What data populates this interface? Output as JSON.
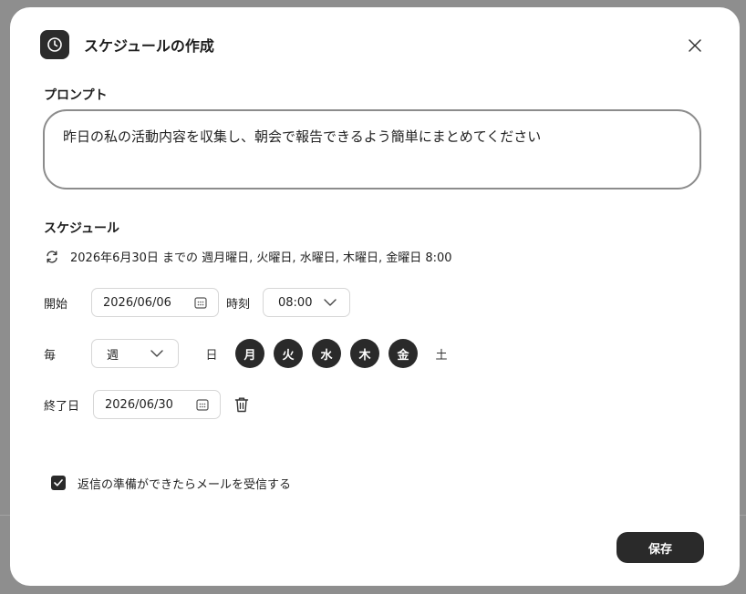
{
  "dialog": {
    "title": "スケジュールの作成",
    "header_icon": "clock-icon",
    "close_icon": "close-icon"
  },
  "prompt": {
    "label": "プロンプト",
    "value": "昨日の私の活動内容を収集し、朝会で報告できるよう簡単にまとめてください"
  },
  "schedule": {
    "label": "スケジュール",
    "summary_icon": "repeat-icon",
    "summary": "2026年6月30日 までの 週月曜日, 火曜日, 水曜日, 木曜日, 金曜日 8:00",
    "start_label": "開始",
    "start_date": "2026/06/06",
    "time_label": "時刻",
    "time_value": "08:00",
    "every_label": "毎",
    "frequency": "週",
    "days": [
      {
        "label": "日",
        "selected": false
      },
      {
        "label": "月",
        "selected": true
      },
      {
        "label": "火",
        "selected": true
      },
      {
        "label": "水",
        "selected": true
      },
      {
        "label": "木",
        "selected": true
      },
      {
        "label": "金",
        "selected": true
      },
      {
        "label": "土",
        "selected": false
      }
    ],
    "end_label": "終了日",
    "end_date": "2026/06/30"
  },
  "notify": {
    "checked": true,
    "label": "返信の準備ができたらメールを受信する"
  },
  "actions": {
    "save_label": "保存"
  },
  "colors": {
    "accent": "#2a2a2a",
    "border": "#8c8c8c",
    "backdrop": "#8e8e8e"
  }
}
